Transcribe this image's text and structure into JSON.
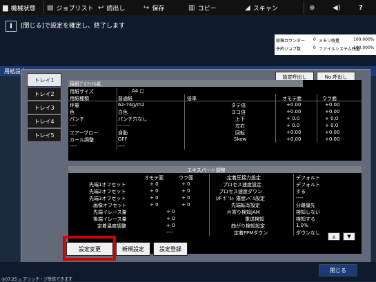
{
  "toolbar": {
    "items": [
      {
        "label": "機械状態"
      },
      {
        "label": "ジョブリスト"
      },
      {
        "label": "読出し"
      },
      {
        "label": "保存"
      },
      {
        "label": "コピー"
      },
      {
        "label": "スキャン"
      }
    ],
    "right_icons": [
      "globe-icon",
      "speaker-icon",
      "help-icon"
    ]
  },
  "message": "[閉じる]で設定を確定し、終了します",
  "counters": [
    {
      "label": "原稿カウンター",
      "value": "0",
      "label2": "メモリ残量",
      "value2": "100.000%"
    },
    {
      "label": "予約ジョブ数",
      "value": "0",
      "label2": "ファイルシステム残量",
      "value2": "100.000%"
    }
  ],
  "title": "用紙設定",
  "trays": [
    "トレイ1",
    "トレイ2",
    "トレイ3",
    "トレイ4",
    "トレイ5"
  ],
  "buttons": {
    "settings_recall": "設定呼出し",
    "number_recall": "No.呼出し",
    "change": "設定変更",
    "new": "新規設定",
    "register": "設定登録",
    "close": "閉じる"
  },
  "paper": {
    "profile_label": "用紙ﾌﾟﾛﾌｧｲﾙ名",
    "rows": [
      {
        "label": "用紙サイズ",
        "value": "A4 □"
      },
      {
        "label": "用紙種類",
        "value": "普通紙"
      },
      {
        "label": "坪量",
        "value": "62-74g/m2"
      },
      {
        "label": "色",
        "value": "白色"
      },
      {
        "label": "パンチ",
        "value": "パンチ穴なし"
      },
      {
        "label": "----",
        "value": "-- ----"
      },
      {
        "label": "エアーブロー",
        "value": "自動"
      },
      {
        "label": "カール調整",
        "value": "OFF"
      },
      {
        "label": "----",
        "value": "----"
      }
    ],
    "mag_header": "倍率",
    "side_headers": [
      "オモテ面",
      "ウラ面"
    ],
    "mag_rows": [
      {
        "label": "タテ倍",
        "front": "+0.00",
        "back": "+0.00"
      },
      {
        "label": "ヨコ倍",
        "front": "+0.00",
        "back": "+0.00"
      },
      {
        "label": "上下",
        "front": "+ 0.0",
        "back": "+ 0.0"
      },
      {
        "label": "左右",
        "front": "+ 0.0",
        "back": "+ 0.0"
      },
      {
        "label": "回転",
        "front": "+0.00",
        "back": "+0.00"
      },
      {
        "label": "Skew",
        "front": "+0.00",
        "back": "+0.00"
      }
    ]
  },
  "expert": {
    "title": "エキスパート調整",
    "col_headers": [
      "オモテ面",
      "ウラ面"
    ],
    "left_rows": [
      {
        "label": "先端1オフセット",
        "front": "+ 0",
        "back": "+ 0"
      },
      {
        "label": "先端2オフセット",
        "front": "+ 0",
        "back": "+ 0"
      },
      {
        "label": "先端3オフセット",
        "front": "+ 0",
        "back": "+ 0"
      },
      {
        "label": "画像オフセット",
        "front": "+ 0",
        "back": "+ 0"
      },
      {
        "label": "先端イレース量",
        "value": "+ 0"
      },
      {
        "label": "後端イレース量",
        "value": "+ 0"
      },
      {
        "label": "定着温度調整",
        "value": "+ 0"
      },
      {
        "label": "",
        "value": "----"
      }
    ],
    "right_rows": [
      {
        "label": "定着圧接力設定",
        "value": "デフォルト"
      },
      {
        "label": "プロセス速度設定",
        "value": "デフォルト"
      },
      {
        "label": "プロセス速度ダウン",
        "value": "する"
      },
      {
        "label": "I/F ﾎﾞ'ﾙﾄ 濃度ﾚﾍﾞﾙ設定",
        "value": "----"
      },
      {
        "label": "先端転写設定",
        "value": "分離優先"
      },
      {
        "label": "片寄り検知JAM",
        "value": "検知しない"
      },
      {
        "label": "重送検知",
        "value": "検知する"
      },
      {
        "label": "曲がり検知設定",
        "value": "1.0%"
      },
      {
        "label": "定着FPMダウン",
        "value": "ダウンなし"
      }
    ]
  },
  "status": "①07:25 △ アリッチ・ジ受信できます"
}
